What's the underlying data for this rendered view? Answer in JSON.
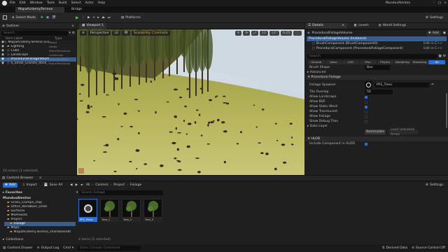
{
  "menubar": {
    "items": [
      "File",
      "Edit",
      "Window",
      "Tools",
      "Build",
      "Select",
      "Actor",
      "Help"
    ],
    "project": "MundusAlentos"
  },
  "tabs": {
    "level": "MapaAcidemyTerreno",
    "bridge": "Bridge"
  },
  "toolbar": {
    "select_mode": "Select Mode",
    "platforms": "Platforms",
    "settings": "Settings"
  },
  "outliner": {
    "title": "Outliner",
    "search_placeholder": "Search...",
    "col_label": "Item Label",
    "col_type": "Type",
    "items": [
      {
        "label": "MapaAcidemyTerreno (Editor)",
        "type": "World",
        "depth": 0,
        "selected": false
      },
      {
        "label": "Lighting",
        "type": "Folder",
        "depth": 1,
        "selected": false
      },
      {
        "label": "Cube",
        "type": "StaticMeshActor",
        "depth": 1,
        "selected": false
      },
      {
        "label": "Landscape",
        "type": "Landscape",
        "depth": 1,
        "selected": false
      },
      {
        "label": "ProceduralFoliageVolume",
        "type": "ProceduralFoli",
        "depth": 1,
        "selected": true
      },
      {
        "label": "S_Small_Granite_Rock_...",
        "type": "StaticMeshActor",
        "depth": 1,
        "selected": false
      }
    ],
    "footer": "10 actors (1 selected)"
  },
  "viewport": {
    "tab": "Viewport 1",
    "perspective": "Perspective",
    "lit": "Lit",
    "scalability": "Scalability: Cinematic",
    "grid": "10",
    "angle": "10°",
    "scale": "0.25"
  },
  "details": {
    "tab": "Details",
    "levels_tab": "Levels",
    "world_settings_tab": "World Settings",
    "actor_name": "ProceduralFoliageVolume",
    "add_label": "Add",
    "instance_label": "ProceduralFoliageVolume (Instance)",
    "components": [
      {
        "name": "BrushComponent (BrushComponent0)",
        "action": "Edit in C++"
      },
      {
        "name": "ProceduralComponent (ProceduralFoliageComponent)",
        "action": "Edit in C++"
      }
    ],
    "search_placeholder": "Search",
    "filters": [
      "General",
      "Actor",
      "LOD",
      "Misc",
      "Physics",
      "Rendering",
      "Streaming",
      "All"
    ],
    "brush_shape_label": "Brush Shape",
    "brush_shape_value": "Box",
    "advanced": "Advanced",
    "section_pf": "Procedural Foliage",
    "foliage_spawner_label": "Foliage Spawner",
    "foliage_spawner_value": "PFS_Trees",
    "tile_overlap_label": "Tile Overlap",
    "tile_overlap_value": "50",
    "checks": [
      {
        "label": "Allow Landscape",
        "on": true
      },
      {
        "label": "Allow BSP",
        "on": false
      },
      {
        "label": "Allow Static Mesh",
        "on": true
      },
      {
        "label": "Allow Translucent",
        "on": false
      },
      {
        "label": "Allow Foliage",
        "on": false
      },
      {
        "label": "Show Debug Tiles",
        "on": false
      }
    ],
    "data_layer": "Data Layer",
    "resimulate": "Resimulate",
    "load_unloaded": "Load Unloaded Areas",
    "section_hlod": "HLOD",
    "include_hlod": "Include Component in HLOD"
  },
  "content_browser": {
    "title": "Content Browser",
    "add": "Add",
    "import": "Import",
    "save_all": "Save All",
    "path": [
      "All",
      "Content",
      "Project",
      "Foliage"
    ],
    "settings": "Settings",
    "search_placeholder": "Search Foliage",
    "favorites": "Favorites",
    "root": "MundusAlentos",
    "folders": [
      "Grass_Clumps_clap",
      "Office_WindBoer_on0e",
      "Surfaces",
      "MSPresets",
      "Project",
      "Foliage",
      "Maps",
      "MapaAcidemyTerreno_shareBasedR"
    ],
    "collections": "Collections",
    "assets": [
      {
        "name": "PFS_Trees",
        "selected": true
      },
      {
        "name": "Tree_1",
        "selected": false
      },
      {
        "name": "Tree_2",
        "selected": false
      },
      {
        "name": "Tree_3",
        "selected": false
      }
    ],
    "footer": "4 items (1 selected)"
  },
  "statusbar": {
    "content_drawer": "Content Drawer",
    "output_log": "Output Log",
    "cmd": "Cmd",
    "cmd_placeholder": "Enter Console Command",
    "derived_data": "Derived Data",
    "source_control": "Source Control Off"
  },
  "colors": {
    "accent": "#2b6fd6",
    "play": "#4fbf4f",
    "selection": "#3b5d8a"
  }
}
